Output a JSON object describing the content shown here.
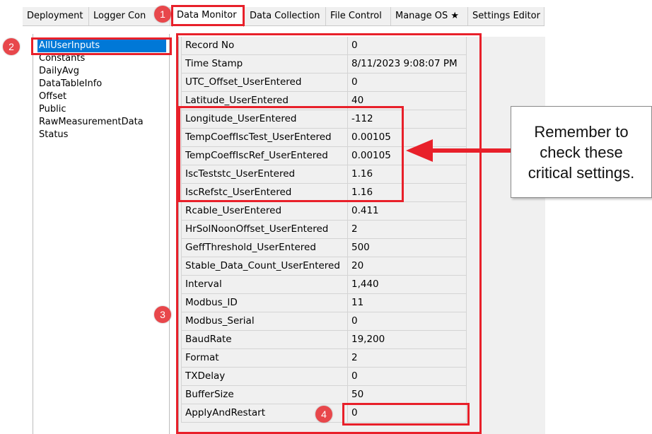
{
  "tabs": [
    {
      "label": "Deployment",
      "active": false
    },
    {
      "label": "Logger Con",
      "active": false
    },
    {
      "label": "Data Monitor",
      "active": true
    },
    {
      "label": "Data Collection",
      "active": false
    },
    {
      "label": "File Control",
      "active": false
    },
    {
      "label": "Manage OS ★",
      "active": false
    },
    {
      "label": "Settings Editor",
      "active": false
    }
  ],
  "tables": [
    {
      "label": "AllUserInputs",
      "selected": true
    },
    {
      "label": "Constants"
    },
    {
      "label": "DailyAvg"
    },
    {
      "label": "DataTableInfo"
    },
    {
      "label": "Offset"
    },
    {
      "label": "Public"
    },
    {
      "label": "RawMeasurementData"
    },
    {
      "label": "Status"
    }
  ],
  "fields": [
    {
      "name": "Record No",
      "value": "0"
    },
    {
      "name": "Time Stamp",
      "value": "8/11/2023 9:08:07 PM"
    },
    {
      "name": "UTC_Offset_UserEntered",
      "value": "0"
    },
    {
      "name": "Latitude_UserEntered",
      "value": "40"
    },
    {
      "name": "Longitude_UserEntered",
      "value": "-112"
    },
    {
      "name": "TempCoeffIscTest_UserEntered",
      "value": "0.00105"
    },
    {
      "name": "TempCoeffIscRef_UserEntered",
      "value": "0.00105"
    },
    {
      "name": "IscTeststc_UserEntered",
      "value": "1.16"
    },
    {
      "name": "IscRefstc_UserEntered",
      "value": "1.16"
    },
    {
      "name": "Rcable_UserEntered",
      "value": "0.411"
    },
    {
      "name": "HrSolNoonOffset_UserEntered",
      "value": "2"
    },
    {
      "name": "GeffThreshold_UserEntered",
      "value": "500"
    },
    {
      "name": "Stable_Data_Count_UserEntered",
      "value": "20"
    },
    {
      "name": "Interval",
      "value": "1,440"
    },
    {
      "name": "Modbus_ID",
      "value": "11"
    },
    {
      "name": "Modbus_Serial",
      "value": "0"
    },
    {
      "name": "BaudRate",
      "value": "19,200"
    },
    {
      "name": "Format",
      "value": "2"
    },
    {
      "name": "TXDelay",
      "value": "0"
    },
    {
      "name": "BufferSize",
      "value": "50"
    },
    {
      "name": "ApplyAndRestart",
      "value": "0"
    }
  ],
  "annotations": {
    "badges": [
      "1",
      "2",
      "3",
      "4"
    ],
    "callout_lines": [
      "Remember to",
      "check these",
      "critical settings."
    ],
    "highlight_color": "#e8202a",
    "badge_color": "#e8474b",
    "selection_color": "#0078d7"
  }
}
